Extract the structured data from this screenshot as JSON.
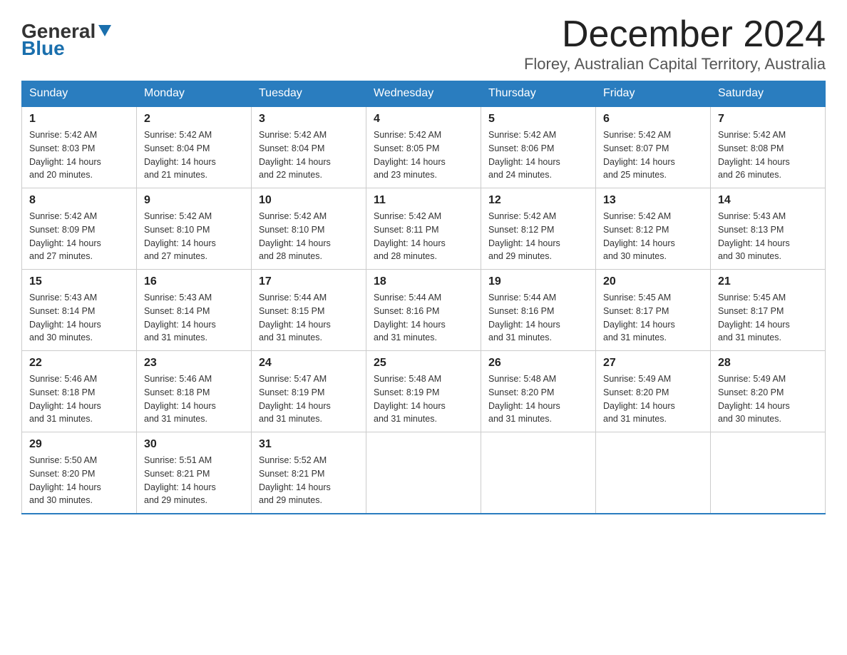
{
  "logo": {
    "general": "General",
    "blue": "Blue"
  },
  "title": "December 2024",
  "location": "Florey, Australian Capital Territory, Australia",
  "days_of_week": [
    "Sunday",
    "Monday",
    "Tuesday",
    "Wednesday",
    "Thursday",
    "Friday",
    "Saturday"
  ],
  "weeks": [
    [
      {
        "day": "1",
        "sunrise": "5:42 AM",
        "sunset": "8:03 PM",
        "daylight": "14 hours and 20 minutes."
      },
      {
        "day": "2",
        "sunrise": "5:42 AM",
        "sunset": "8:04 PM",
        "daylight": "14 hours and 21 minutes."
      },
      {
        "day": "3",
        "sunrise": "5:42 AM",
        "sunset": "8:04 PM",
        "daylight": "14 hours and 22 minutes."
      },
      {
        "day": "4",
        "sunrise": "5:42 AM",
        "sunset": "8:05 PM",
        "daylight": "14 hours and 23 minutes."
      },
      {
        "day": "5",
        "sunrise": "5:42 AM",
        "sunset": "8:06 PM",
        "daylight": "14 hours and 24 minutes."
      },
      {
        "day": "6",
        "sunrise": "5:42 AM",
        "sunset": "8:07 PM",
        "daylight": "14 hours and 25 minutes."
      },
      {
        "day": "7",
        "sunrise": "5:42 AM",
        "sunset": "8:08 PM",
        "daylight": "14 hours and 26 minutes."
      }
    ],
    [
      {
        "day": "8",
        "sunrise": "5:42 AM",
        "sunset": "8:09 PM",
        "daylight": "14 hours and 27 minutes."
      },
      {
        "day": "9",
        "sunrise": "5:42 AM",
        "sunset": "8:10 PM",
        "daylight": "14 hours and 27 minutes."
      },
      {
        "day": "10",
        "sunrise": "5:42 AM",
        "sunset": "8:10 PM",
        "daylight": "14 hours and 28 minutes."
      },
      {
        "day": "11",
        "sunrise": "5:42 AM",
        "sunset": "8:11 PM",
        "daylight": "14 hours and 28 minutes."
      },
      {
        "day": "12",
        "sunrise": "5:42 AM",
        "sunset": "8:12 PM",
        "daylight": "14 hours and 29 minutes."
      },
      {
        "day": "13",
        "sunrise": "5:42 AM",
        "sunset": "8:12 PM",
        "daylight": "14 hours and 30 minutes."
      },
      {
        "day": "14",
        "sunrise": "5:43 AM",
        "sunset": "8:13 PM",
        "daylight": "14 hours and 30 minutes."
      }
    ],
    [
      {
        "day": "15",
        "sunrise": "5:43 AM",
        "sunset": "8:14 PM",
        "daylight": "14 hours and 30 minutes."
      },
      {
        "day": "16",
        "sunrise": "5:43 AM",
        "sunset": "8:14 PM",
        "daylight": "14 hours and 31 minutes."
      },
      {
        "day": "17",
        "sunrise": "5:44 AM",
        "sunset": "8:15 PM",
        "daylight": "14 hours and 31 minutes."
      },
      {
        "day": "18",
        "sunrise": "5:44 AM",
        "sunset": "8:16 PM",
        "daylight": "14 hours and 31 minutes."
      },
      {
        "day": "19",
        "sunrise": "5:44 AM",
        "sunset": "8:16 PM",
        "daylight": "14 hours and 31 minutes."
      },
      {
        "day": "20",
        "sunrise": "5:45 AM",
        "sunset": "8:17 PM",
        "daylight": "14 hours and 31 minutes."
      },
      {
        "day": "21",
        "sunrise": "5:45 AM",
        "sunset": "8:17 PM",
        "daylight": "14 hours and 31 minutes."
      }
    ],
    [
      {
        "day": "22",
        "sunrise": "5:46 AM",
        "sunset": "8:18 PM",
        "daylight": "14 hours and 31 minutes."
      },
      {
        "day": "23",
        "sunrise": "5:46 AM",
        "sunset": "8:18 PM",
        "daylight": "14 hours and 31 minutes."
      },
      {
        "day": "24",
        "sunrise": "5:47 AM",
        "sunset": "8:19 PM",
        "daylight": "14 hours and 31 minutes."
      },
      {
        "day": "25",
        "sunrise": "5:48 AM",
        "sunset": "8:19 PM",
        "daylight": "14 hours and 31 minutes."
      },
      {
        "day": "26",
        "sunrise": "5:48 AM",
        "sunset": "8:20 PM",
        "daylight": "14 hours and 31 minutes."
      },
      {
        "day": "27",
        "sunrise": "5:49 AM",
        "sunset": "8:20 PM",
        "daylight": "14 hours and 31 minutes."
      },
      {
        "day": "28",
        "sunrise": "5:49 AM",
        "sunset": "8:20 PM",
        "daylight": "14 hours and 30 minutes."
      }
    ],
    [
      {
        "day": "29",
        "sunrise": "5:50 AM",
        "sunset": "8:20 PM",
        "daylight": "14 hours and 30 minutes."
      },
      {
        "day": "30",
        "sunrise": "5:51 AM",
        "sunset": "8:21 PM",
        "daylight": "14 hours and 29 minutes."
      },
      {
        "day": "31",
        "sunrise": "5:52 AM",
        "sunset": "8:21 PM",
        "daylight": "14 hours and 29 minutes."
      },
      null,
      null,
      null,
      null
    ]
  ],
  "labels": {
    "sunrise": "Sunrise:",
    "sunset": "Sunset:",
    "daylight": "Daylight:"
  }
}
